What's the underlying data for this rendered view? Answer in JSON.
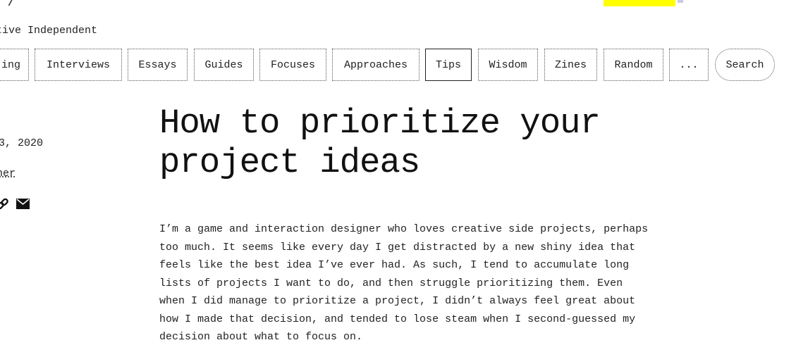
{
  "site": {
    "logo_fragment": "⁄",
    "tagline": "tive Independent",
    "highlight_color": "#ffff00"
  },
  "nav": {
    "items": [
      {
        "label": "ing"
      },
      {
        "label": "Interviews"
      },
      {
        "label": "Essays"
      },
      {
        "label": "Guides"
      },
      {
        "label": "Focuses"
      },
      {
        "label": "Approaches"
      },
      {
        "label": "Tips",
        "active": true
      },
      {
        "label": "Wisdom"
      },
      {
        "label": "Zines"
      },
      {
        "label": "Random"
      },
      {
        "label": "..."
      }
    ],
    "search_label": "Search"
  },
  "meta": {
    "date": ", 2020",
    "date_digit_fragment": "3",
    "author": "her",
    "share_icons": [
      "link-icon",
      "email-icon"
    ]
  },
  "article": {
    "title": "How to prioritize your project ideas",
    "body": "I’m a game and interaction designer who loves creative side projects, perhaps too much. It seems like every day I get distracted by a new shiny idea that feels like the best idea I’ve ever had. As such, I tend to accumulate long lists of projects I want to do, and then struggle prioritizing them. Even when I did manage to prioritize a project, I didn’t always feel great about how I made that decision, and tended to lose steam when I second-guessed my decision about what to focus on."
  }
}
